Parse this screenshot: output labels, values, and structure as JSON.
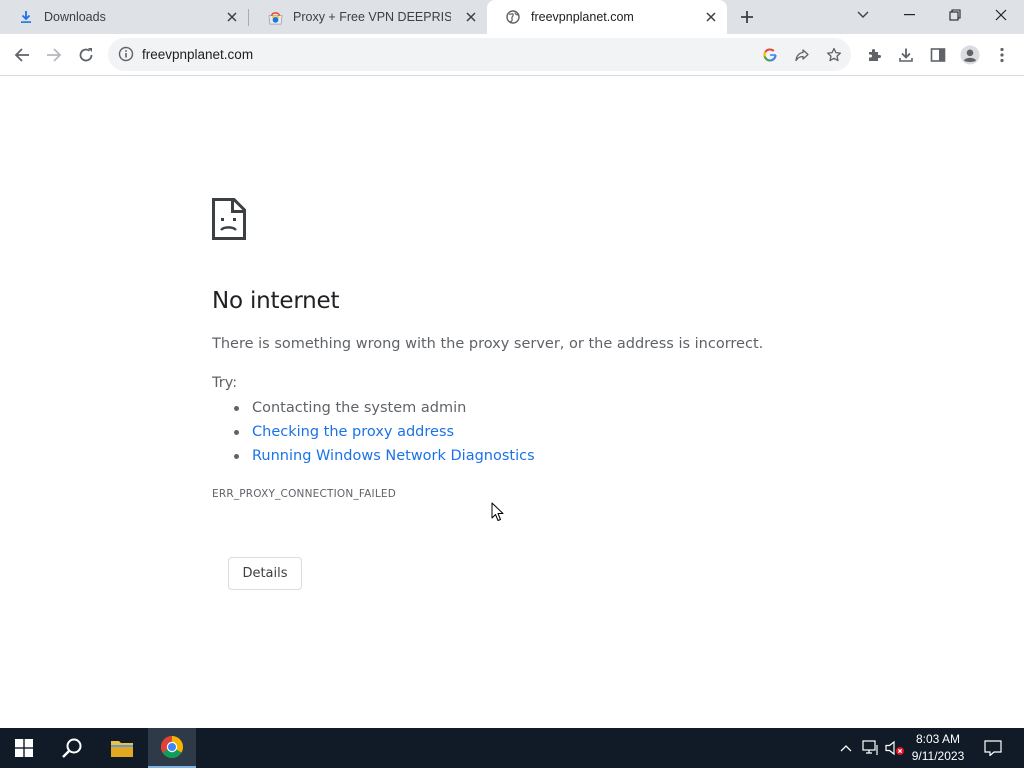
{
  "tabs": [
    {
      "title": "Downloads",
      "icon": "download-icon",
      "active": false
    },
    {
      "title": "Proxy + Free VPN DEEPRISM - Ch",
      "icon": "chrome-web-store-icon",
      "active": false
    },
    {
      "title": "freevpnplanet.com",
      "icon": "globe-icon",
      "active": true
    }
  ],
  "omnibox": {
    "url": "freevpnplanet.com"
  },
  "error_page": {
    "heading": "No internet",
    "message": "There is something wrong with the proxy server, or the address is incorrect.",
    "try_label": "Try:",
    "suggestions": [
      {
        "text": "Contacting the system admin",
        "is_link": false
      },
      {
        "text": "Checking the proxy address",
        "is_link": true
      },
      {
        "text": "Running Windows Network Diagnostics",
        "is_link": true
      }
    ],
    "error_code": "ERR_PROXY_CONNECTION_FAILED",
    "details_button": "Details"
  },
  "taskbar": {
    "time": "8:03 AM",
    "date": "9/11/2023"
  },
  "colors": {
    "link": "#1a73e8",
    "taskbar_bg": "#101b27",
    "tabstrip_bg": "#dee1e6"
  }
}
